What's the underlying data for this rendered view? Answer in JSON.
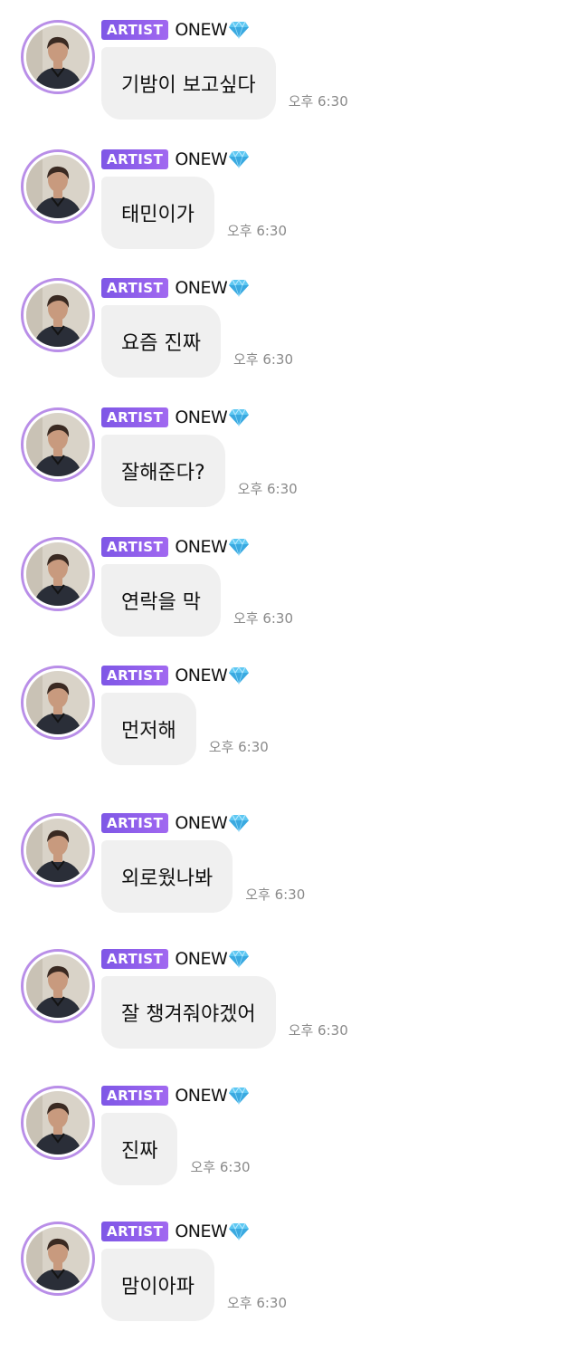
{
  "messages": [
    {
      "badge": "ARTIST",
      "username": "ONEW",
      "name_icon": "diamond-icon",
      "text": "기밤이 보고싶다",
      "time": "오후 6:30"
    },
    {
      "badge": "ARTIST",
      "username": "ONEW",
      "name_icon": "diamond-icon",
      "text": "태민이가",
      "time": "오후 6:30"
    },
    {
      "badge": "ARTIST",
      "username": "ONEW",
      "name_icon": "diamond-icon",
      "text": "요즘 진짜",
      "time": "오후 6:30"
    },
    {
      "badge": "ARTIST",
      "username": "ONEW",
      "name_icon": "diamond-icon",
      "text": "잘해준다?",
      "time": "오후 6:30"
    },
    {
      "badge": "ARTIST",
      "username": "ONEW",
      "name_icon": "diamond-icon",
      "text": "연락을 막",
      "time": "오후 6:30"
    },
    {
      "badge": "ARTIST",
      "username": "ONEW",
      "name_icon": "diamond-icon",
      "text": "먼저해",
      "time": "오후 6:30"
    },
    {
      "badge": "ARTIST",
      "username": "ONEW",
      "name_icon": "diamond-icon",
      "text": "외로웠나봐",
      "time": "오후 6:30"
    },
    {
      "badge": "ARTIST",
      "username": "ONEW",
      "name_icon": "diamond-icon",
      "text": "잘 챙겨줘야겠어",
      "time": "오후 6:30"
    },
    {
      "badge": "ARTIST",
      "username": "ONEW",
      "name_icon": "diamond-icon",
      "text": "진짜",
      "time": "오후 6:30"
    },
    {
      "badge": "ARTIST",
      "username": "ONEW",
      "name_icon": "diamond-icon",
      "text": "맘이아파",
      "time": "오후 6:30"
    }
  ],
  "colors": {
    "badge_start": "#7e57e6",
    "badge_end": "#a168f0",
    "avatar_ring": "#b98ee8",
    "bubble_bg": "#f0f0f0",
    "timestamp": "#8a8a8a",
    "diamond": "#4fc3f7"
  }
}
